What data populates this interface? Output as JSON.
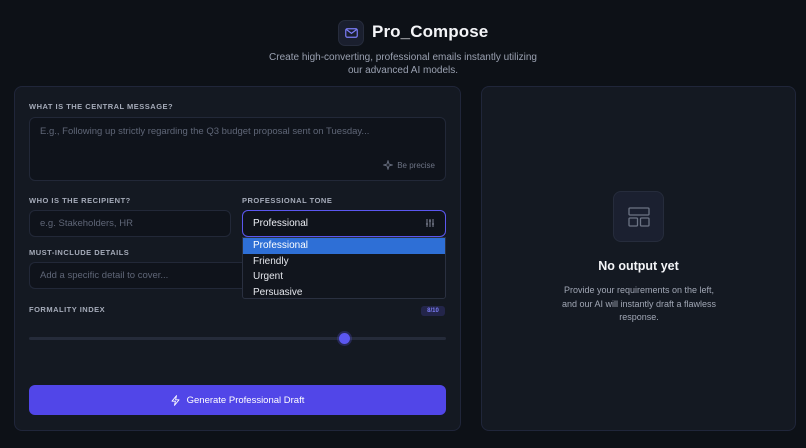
{
  "header": {
    "app_name": "Pro_Compose",
    "subtitle": "Create high-converting, professional emails instantly utilizing our advanced AI models."
  },
  "form": {
    "message": {
      "label": "WHAT IS THE CENTRAL MESSAGE?",
      "placeholder": "E.g., Following up strictly regarding the Q3 budget proposal sent on Tuesday...",
      "hint": "Be precise"
    },
    "recipient": {
      "label": "WHO IS THE RECIPIENT?",
      "placeholder": "e.g. Stakeholders, HR"
    },
    "tone": {
      "label": "PROFESSIONAL TONE",
      "selected": "Professional",
      "options": [
        "Professional",
        "Friendly",
        "Urgent",
        "Persuasive"
      ]
    },
    "details": {
      "label": "MUST-INCLUDE DETAILS",
      "placeholder": "Add a specific detail to cover..."
    },
    "formality": {
      "label": "FORMALITY INDEX",
      "badge": "8/10",
      "value": 8,
      "max": 10
    },
    "generate_label": "Generate Professional Draft"
  },
  "output": {
    "title": "No output yet",
    "description": "Provide your requirements on the left, and our AI will instantly draft a flawless response."
  },
  "colors": {
    "accent": "#5146e8",
    "selected_option": "#2e6fd6",
    "background": "#0d1117"
  }
}
